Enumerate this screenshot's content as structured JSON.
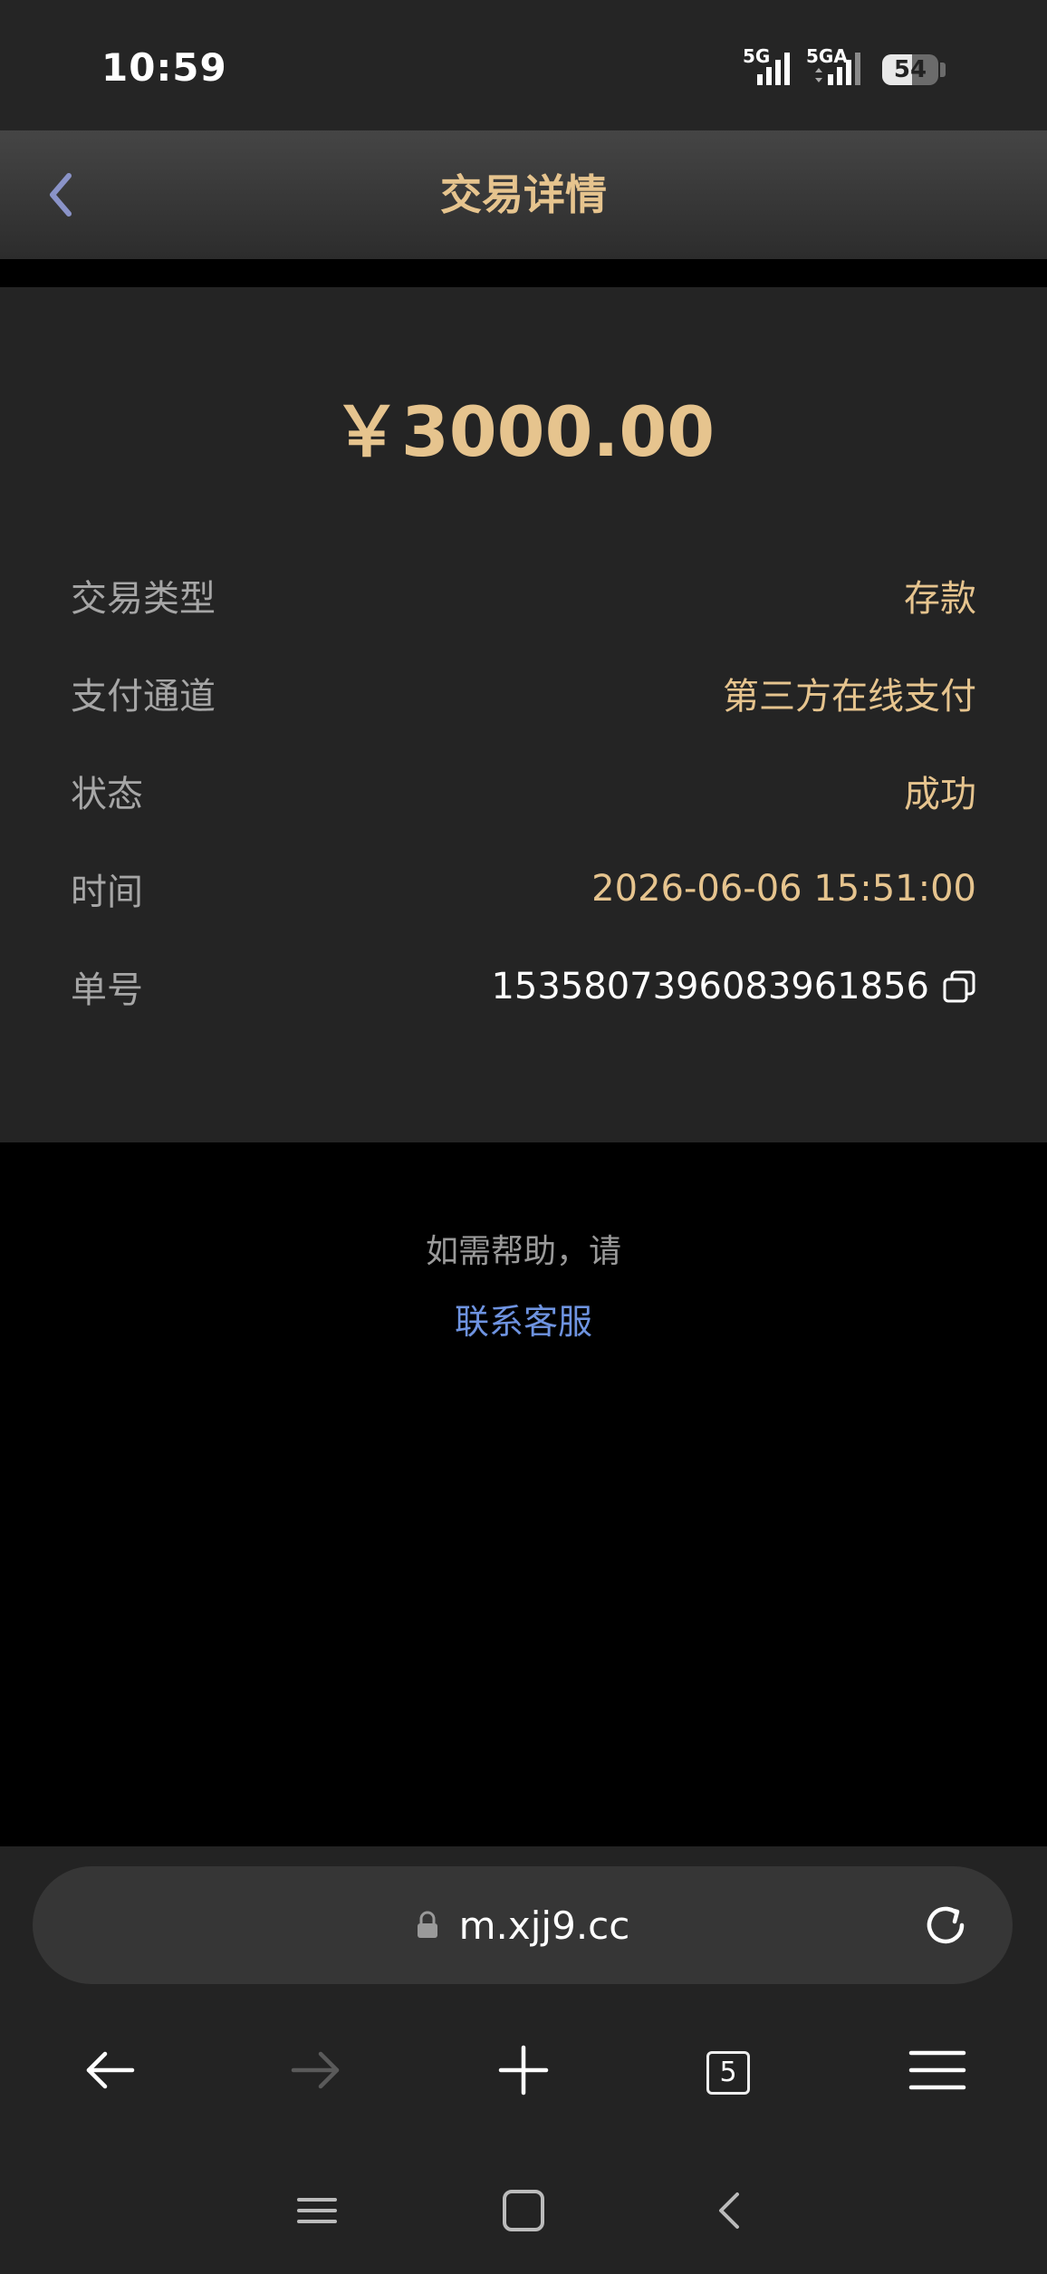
{
  "status_bar": {
    "time": "10:59",
    "signal1_label": "5G",
    "signal2_label": "5GA",
    "battery": "54"
  },
  "header": {
    "title": "交易详情"
  },
  "transaction": {
    "amount": "￥3000.00",
    "rows": [
      {
        "label": "交易类型",
        "value": "存款"
      },
      {
        "label": "支付通道",
        "value": "第三方在线支付"
      },
      {
        "label": "状态",
        "value": "成功"
      },
      {
        "label": "时间",
        "value": "2026-06-06 15:51:00"
      },
      {
        "label": "单号",
        "value": "1535807396083961856"
      }
    ]
  },
  "help": {
    "text": "如需帮助，请",
    "link": "联系客服"
  },
  "browser": {
    "url": "m.xjj9.cc",
    "tabs_count": "5"
  },
  "colors": {
    "accent_gold": "#e6c48e",
    "link_blue": "#6e93e0",
    "card_bg": "#242424"
  }
}
